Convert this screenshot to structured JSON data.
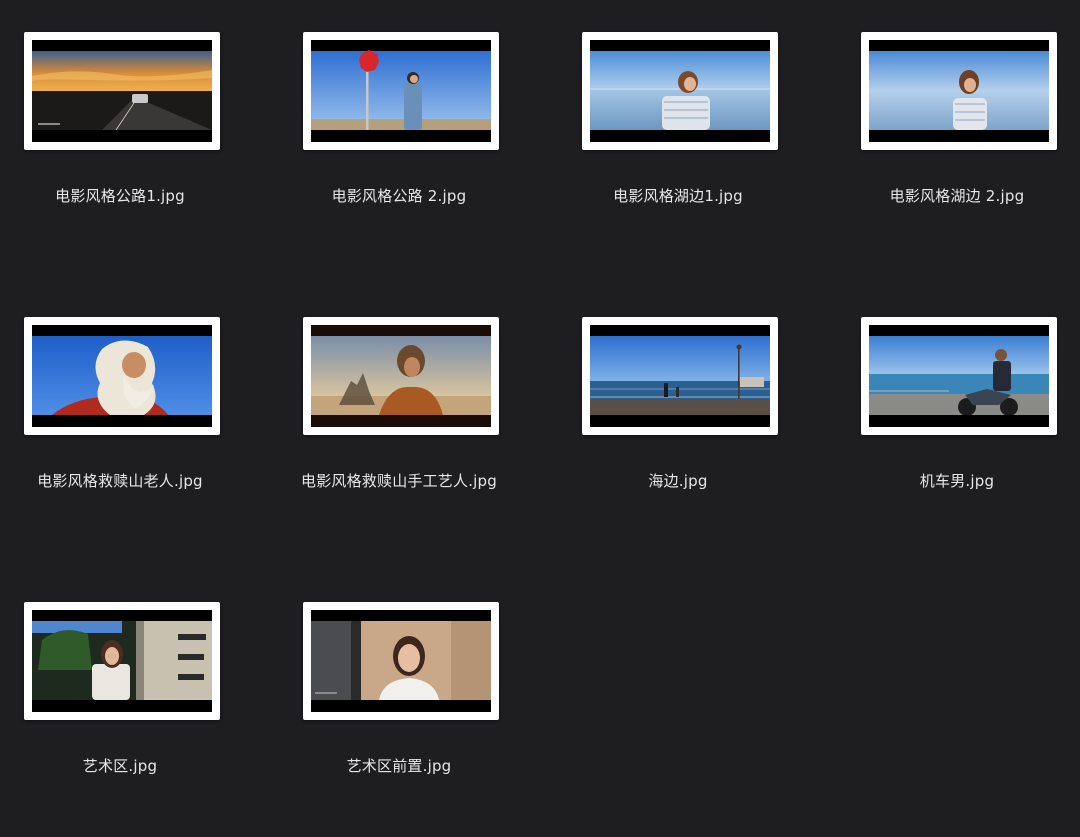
{
  "files": [
    {
      "name": "电影风格公路1.jpg"
    },
    {
      "name": "电影风格公路 2.jpg"
    },
    {
      "name": "电影风格湖边1.jpg"
    },
    {
      "name": "电影风格湖边 2.jpg"
    },
    {
      "name": "电影风格救赎山老人.jpg"
    },
    {
      "name": "电影风格救赎山手工艺人.jpg"
    },
    {
      "name": "海边.jpg"
    },
    {
      "name": "机车男.jpg"
    },
    {
      "name": "艺术区.jpg"
    },
    {
      "name": "艺术区前置.jpg"
    }
  ],
  "colors": {
    "background": "#1e1e21",
    "label_text": "#e6e6e8",
    "thumbnail_border": "#ffffff"
  }
}
